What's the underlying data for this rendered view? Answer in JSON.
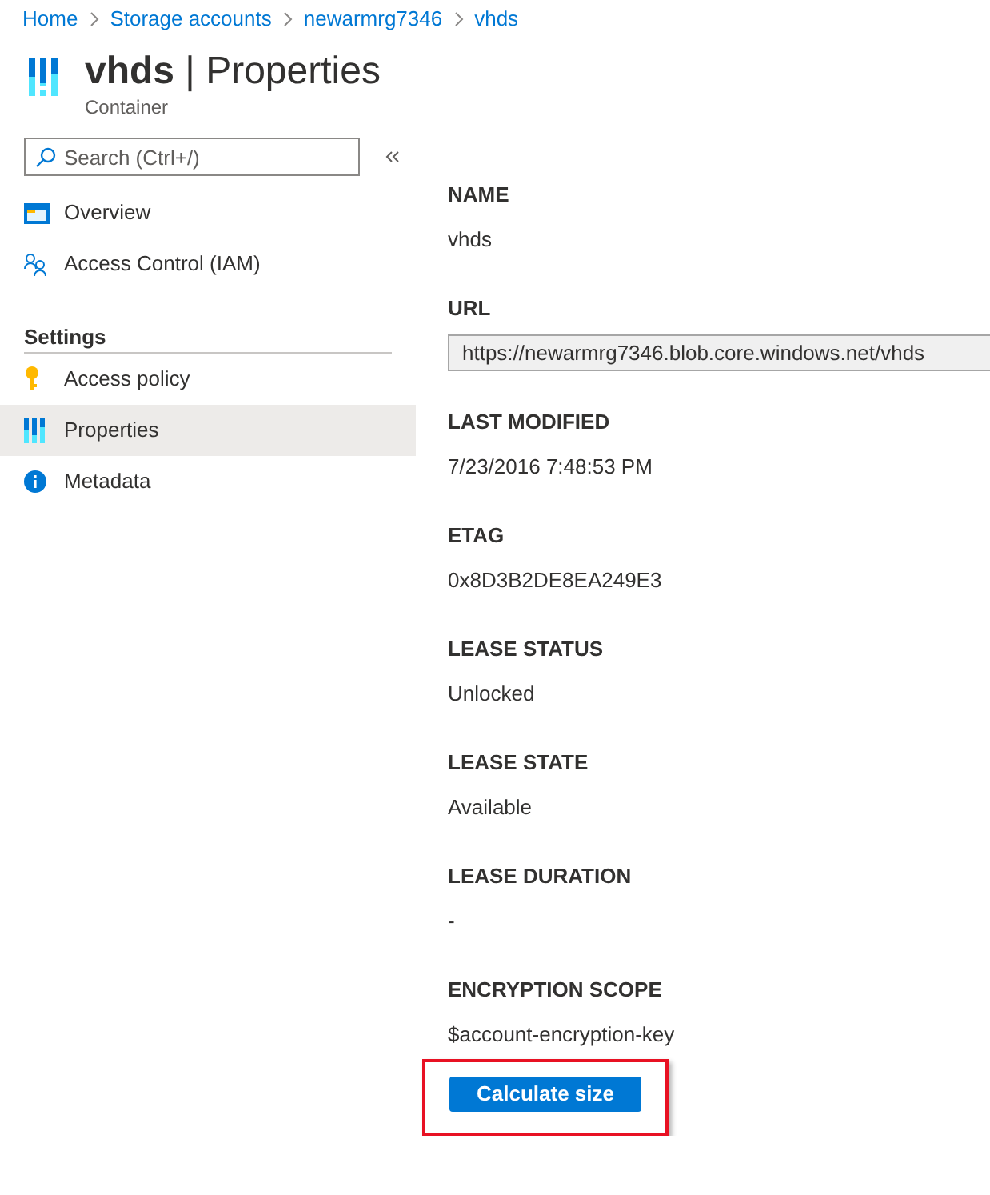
{
  "breadcrumb": [
    "Home",
    "Storage accounts",
    "newarmrg7346",
    "vhds"
  ],
  "header": {
    "title": "**vhds** | Properties",
    "resource_type": "Container"
  },
  "search": {
    "placeholder": "Search (Ctrl+/)"
  },
  "sidebar": {
    "items": [
      {
        "kind": "item",
        "label": "Overview",
        "selected": false
      },
      {
        "kind": "item",
        "label": "Access Control (IAM)",
        "selected": false
      },
      {
        "kind": "section",
        "label": "Settings"
      },
      {
        "kind": "item",
        "label": "Access policy",
        "selected": false
      },
      {
        "kind": "item",
        "label": "Properties",
        "selected": true
      },
      {
        "kind": "item",
        "label": "Metadata",
        "selected": false
      }
    ]
  },
  "properties": [
    {
      "kind": "text",
      "label": "NAME",
      "value": "vhds"
    },
    {
      "kind": "field",
      "label": "URL",
      "value": "https://newarmrg7346.blob.core.windows.net/vhds"
    },
    {
      "kind": "text",
      "label": "LAST MODIFIED",
      "value": "7/23/2016 7:48:53 PM"
    },
    {
      "kind": "text",
      "label": "ETAG",
      "value": "0x8D3B2DE8EA249E3"
    },
    {
      "kind": "text",
      "label": "LEASE STATUS",
      "value": "Unlocked"
    },
    {
      "kind": "text",
      "label": "LEASE STATE",
      "value": "Available"
    },
    {
      "kind": "text",
      "label": "LEASE DURATION",
      "value": "-"
    },
    {
      "kind": "text",
      "label": "ENCRYPTION SCOPE",
      "value": "$account-encryption-key"
    }
  ],
  "button": {
    "label": "Calculate size",
    "highlighted": true
  }
}
